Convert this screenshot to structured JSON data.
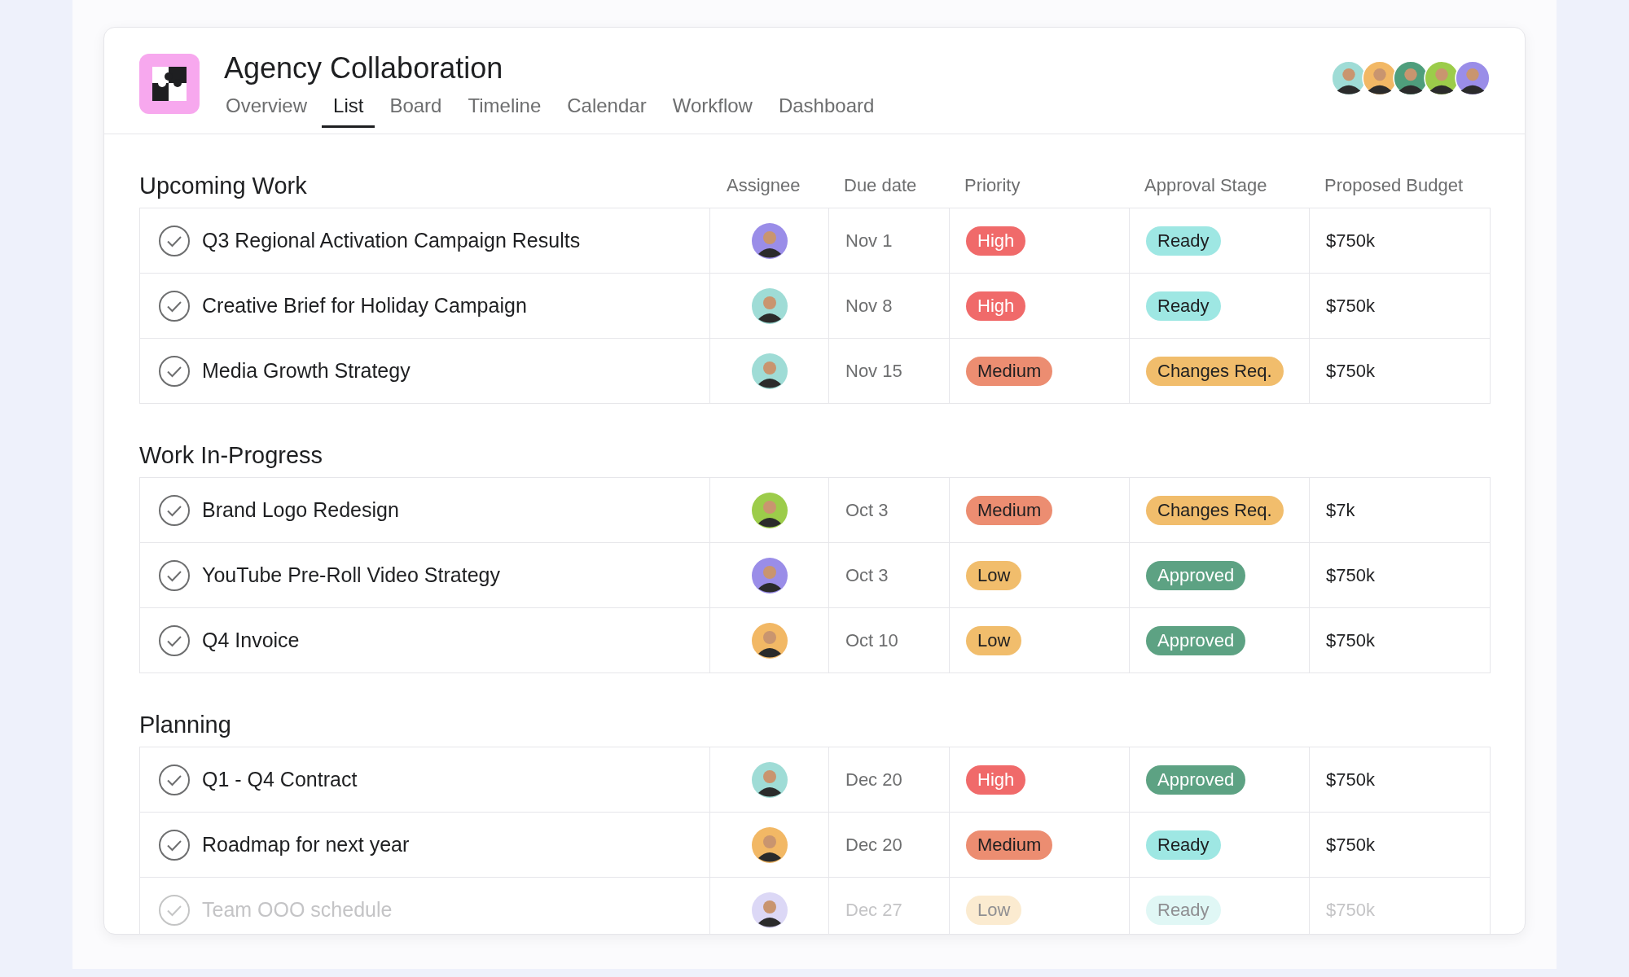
{
  "project": {
    "title": "Agency Collaboration"
  },
  "tabs": [
    {
      "label": "Overview",
      "selected": false
    },
    {
      "label": "List",
      "selected": true
    },
    {
      "label": "Board",
      "selected": false
    },
    {
      "label": "Timeline",
      "selected": false
    },
    {
      "label": "Calendar",
      "selected": false
    },
    {
      "label": "Workflow",
      "selected": false
    },
    {
      "label": "Dashboard",
      "selected": false
    }
  ],
  "members": [
    {
      "color": "#9fdcd6"
    },
    {
      "color": "#f2b865"
    },
    {
      "color": "#4f9e7c"
    },
    {
      "color": "#9ccc4a"
    },
    {
      "color": "#9a8de8"
    }
  ],
  "columns": [
    "Assignee",
    "Due date",
    "Priority",
    "Approval Stage",
    "Proposed Budget"
  ],
  "sections": [
    {
      "title": "Upcoming Work",
      "rows": [
        {
          "task": "Q3 Regional Activation Campaign Results",
          "assignee": {
            "color": "#9a8de8"
          },
          "due": "Nov 1",
          "priority": {
            "label": "High",
            "color": "#f06a6a"
          },
          "stage": {
            "label": "Ready",
            "color": "#9ee7e3"
          },
          "budget": "$750k",
          "faded": false
        },
        {
          "task": "Creative Brief for Holiday Campaign",
          "assignee": {
            "color": "#9fdcd6"
          },
          "due": "Nov 8",
          "priority": {
            "label": "High",
            "color": "#f06a6a"
          },
          "stage": {
            "label": "Ready",
            "color": "#9ee7e3"
          },
          "budget": "$750k",
          "faded": false
        },
        {
          "task": "Media Growth Strategy",
          "assignee": {
            "color": "#9fdcd6"
          },
          "due": "Nov 15",
          "priority": {
            "label": "Medium",
            "color": "#ec8d71"
          },
          "stage": {
            "label": "Changes Req.",
            "color": "#f1bd6c"
          },
          "budget": "$750k",
          "faded": false
        }
      ]
    },
    {
      "title": "Work In-Progress",
      "rows": [
        {
          "task": "Brand Logo Redesign",
          "assignee": {
            "color": "#9ccc4a"
          },
          "due": "Oct 3",
          "priority": {
            "label": "Medium",
            "color": "#ec8d71"
          },
          "stage": {
            "label": "Changes Req.",
            "color": "#f1bd6c"
          },
          "budget": "$7k",
          "faded": false
        },
        {
          "task": "YouTube Pre-Roll Video Strategy",
          "assignee": {
            "color": "#9a8de8"
          },
          "due": "Oct 3",
          "priority": {
            "label": "Low",
            "color": "#f1bd6c"
          },
          "stage": {
            "label": "Approved",
            "color": "#5da283"
          },
          "budget": "$750k",
          "faded": false
        },
        {
          "task": "Q4 Invoice",
          "assignee": {
            "color": "#f2b865"
          },
          "due": "Oct 10",
          "priority": {
            "label": "Low",
            "color": "#f1bd6c"
          },
          "stage": {
            "label": "Approved",
            "color": "#5da283"
          },
          "budget": "$750k",
          "faded": false
        }
      ]
    },
    {
      "title": "Planning",
      "rows": [
        {
          "task": "Q1 - Q4 Contract",
          "assignee": {
            "color": "#9fdcd6"
          },
          "due": "Dec 20",
          "priority": {
            "label": "High",
            "color": "#f06a6a"
          },
          "stage": {
            "label": "Approved",
            "color": "#5da283"
          },
          "budget": "$750k",
          "faded": false
        },
        {
          "task": "Roadmap for next year",
          "assignee": {
            "color": "#f2b865"
          },
          "due": "Dec 20",
          "priority": {
            "label": "Medium",
            "color": "#ec8d71"
          },
          "stage": {
            "label": "Ready",
            "color": "#9ee7e3"
          },
          "budget": "$750k",
          "faded": false
        },
        {
          "task": "Team OOO schedule",
          "assignee": {
            "color": "#dcd8f6"
          },
          "due": "Dec 27",
          "priority": {
            "label": "Low",
            "color": "#fbebd0"
          },
          "stage": {
            "label": "Ready",
            "color": "#e0f7f5"
          },
          "budget": "$750k",
          "faded": true
        }
      ]
    }
  ]
}
